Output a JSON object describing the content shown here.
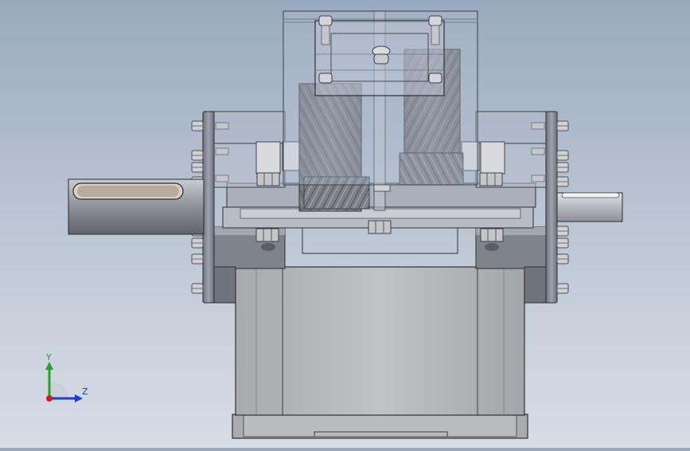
{
  "viewport": {
    "background_top": "#9aa9bd",
    "background_bottom": "#d7dde5",
    "model": "gearbox-assembly-front-view"
  },
  "triad": {
    "y_label": "Y",
    "z_label": "Z",
    "y_color": "#22a32a",
    "z_color": "#1f3bd6",
    "x_color": "#d21b1b"
  }
}
